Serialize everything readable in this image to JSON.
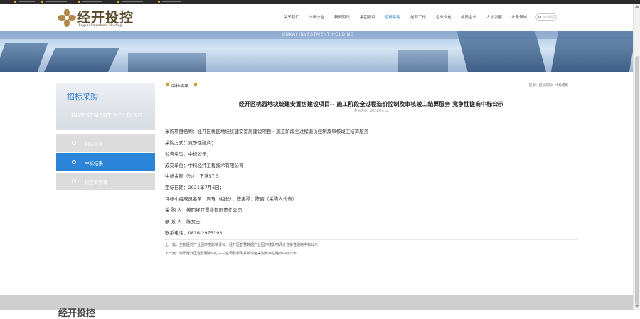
{
  "header": {
    "logo_cn": "经开投控",
    "logo_en": "Jingkai Investment Holding",
    "search_placeholder": "站内搜索"
  },
  "nav": {
    "items": [
      "关于我们",
      "公示公告",
      "新闻资讯",
      "集团项目",
      "招标采购",
      "党群工作",
      "企业文化",
      "成员企业",
      "人才发展",
      "业务领域"
    ],
    "active": "招标采购"
  },
  "banner": {
    "text": "JINKAI INVESTMENT HOLDING"
  },
  "sidebar": {
    "title_cn": "招标采购",
    "title_en": "INVESTMENT HOLDING",
    "items": [
      {
        "label": "招标信息"
      },
      {
        "label": "中标结果"
      },
      {
        "label": "供应商管理"
      }
    ]
  },
  "crumb": {
    "title": "中标结果",
    "path": "首页> 招标采购> 中标结果"
  },
  "article": {
    "title": "经开区桃园地块统建安置房建设项目-- 施工阶段全过程造价控制及审核竣工结算服务 竞争性磋商中标公示",
    "date": "发布时间：2021.07.12",
    "lines": [
      "采购项目名称：经开区桃园地块统建安置房建设项目-- 施工阶段全过程造价控制及审核竣工结算服务",
      "采购方式：竞争性磋商；",
      "公告类型：中标公示；",
      "成交单位：中科经纬工程技术有限公司",
      "中标金额（%）：下浮57.5",
      "定标日期：2021年7月6日；",
      "评标小组成员名单：周瑾（组长）、陈惠琴、陈丽（采购人代表）",
      "采 购 人：绵阳经开置业有限责任公司",
      "联 系 人：陈女士",
      "联系电话：0816-2975193"
    ],
    "prev": "上一篇：生物医药产业园环境影响评价：经开区智慧数据产业园环境影响评价竞争性磋商中标公示",
    "next": "下一篇：绵阳经开区党群服务中心——空调及新风系统设备采购竞争性磋商中标公示"
  },
  "footer": {
    "logo_cn": "经开投控"
  },
  "colors": {
    "accent": "#2c84d8",
    "brand": "#5a4a2a",
    "sidebar_inactive": "#dcdcdc"
  }
}
